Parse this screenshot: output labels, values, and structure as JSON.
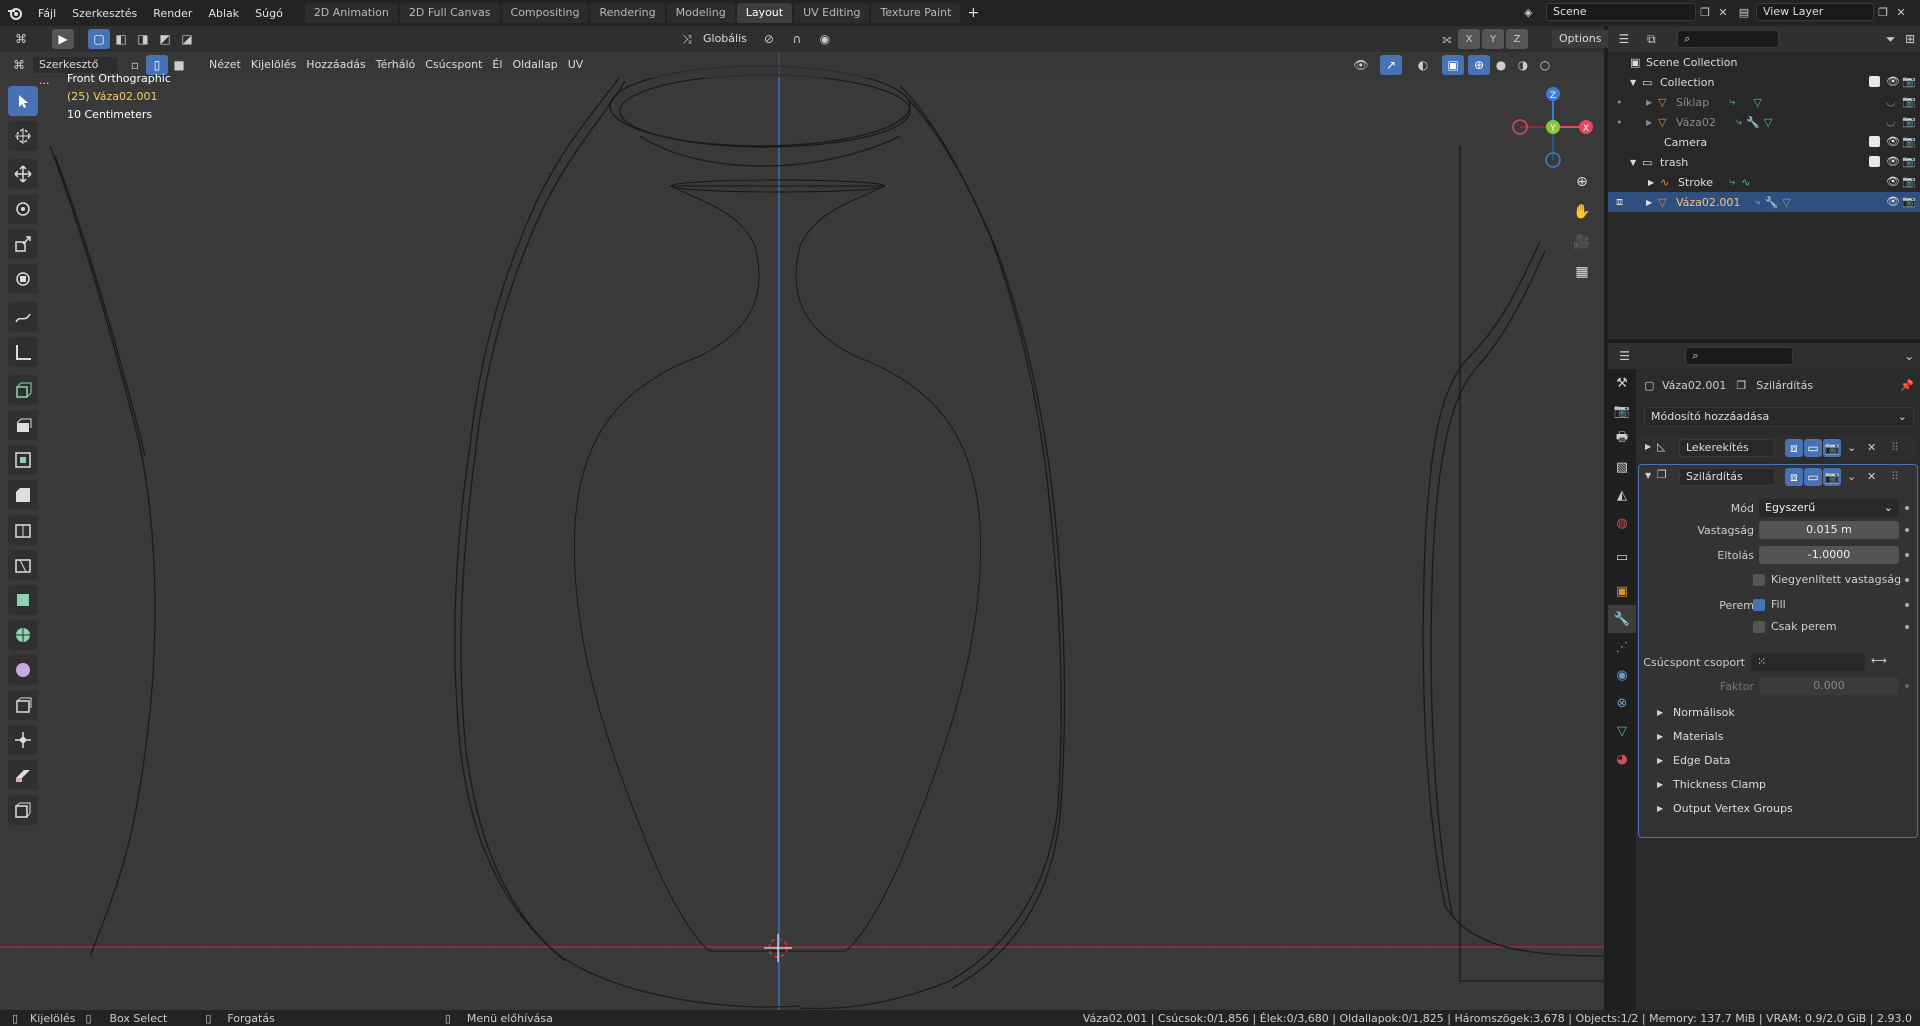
{
  "topbar": {
    "menus": [
      "Fájl",
      "Szerkesztés",
      "Render",
      "Ablak",
      "Súgó"
    ],
    "workspaces": [
      "2D Animation",
      "2D Full Canvas",
      "Compositing",
      "Rendering",
      "Modeling",
      "Layout",
      "UV Editing",
      "Texture Paint"
    ],
    "active_workspace": "Layout",
    "add_tab": "+",
    "scene": "Scene",
    "view_layer": "View Layer"
  },
  "viewport": {
    "editor_type": "Szerkesztő ...",
    "menus": [
      "Nézet",
      "Kijelölés",
      "Hozzáadás",
      "Térháló",
      "Csúcspont",
      "Él",
      "Oldallap",
      "UV"
    ],
    "transform_orientation": "Globális",
    "axes": [
      "X",
      "Y",
      "Z"
    ],
    "options_label": "Options",
    "info_view": "Front Orthographic",
    "info_object": "(25) Váza02.001",
    "info_scale": "10 Centimeters",
    "gizmo": {
      "x": "X",
      "y": "Y",
      "z": "Z"
    }
  },
  "outliner": {
    "search_placeholder": "",
    "rows": [
      {
        "label": "Scene Collection"
      },
      {
        "label": "Collection"
      },
      {
        "label": "Síklap"
      },
      {
        "label": "Váza02"
      },
      {
        "label": "Camera"
      },
      {
        "label": "trash"
      },
      {
        "label": "Stroke"
      },
      {
        "label": "Váza02.001"
      }
    ]
  },
  "properties": {
    "object_name": "Váza02.001",
    "modifier_context": "Szilárdítás",
    "add_modifier": "Módosító hozzáadása",
    "modifiers": [
      {
        "name": "Lekerekítés"
      },
      {
        "name": "Szilárdítás"
      }
    ],
    "solidify": {
      "mode_label": "Mód",
      "mode_value": "Egyszerű",
      "thickness_label": "Vastagság",
      "thickness_value": "0.015 m",
      "offset_label": "Eltolás",
      "offset_value": "-1.0000",
      "even_thickness": "Kiegyenlített vastagság",
      "rim_label": "Perem",
      "fill": "Fill",
      "only_rim": "Csak perem",
      "vertex_group_label": "Csúcspont csoport",
      "factor_label": "Faktor",
      "factor_value": "0.000",
      "subpanels": [
        "Normálisok",
        "Materials",
        "Edge Data",
        "Thickness Clamp",
        "Output Vertex Groups"
      ]
    }
  },
  "status": {
    "select": "Kijelölés",
    "box_select": "Box Select",
    "rotate": "Forgatás",
    "context_menu": "Menü előhívása",
    "stats": "Váza02.001 | Csúcsok:0/1,856 | Élek:0/3,680 | Oldallapok:0/1,825 | Háromszögek:3,678 | Objects:1/2 | Memory: 137.7 MiB | VRAM: 0.9/2.0 GiB | 2.93.0"
  },
  "colors": {
    "accent": "#4772b3",
    "viewport_bg": "#393939",
    "active_object_text": "#f2d05a",
    "x_axis": "#e04a5a",
    "y_axis": "#8bc63a",
    "z_axis": "#3a7fd4"
  }
}
